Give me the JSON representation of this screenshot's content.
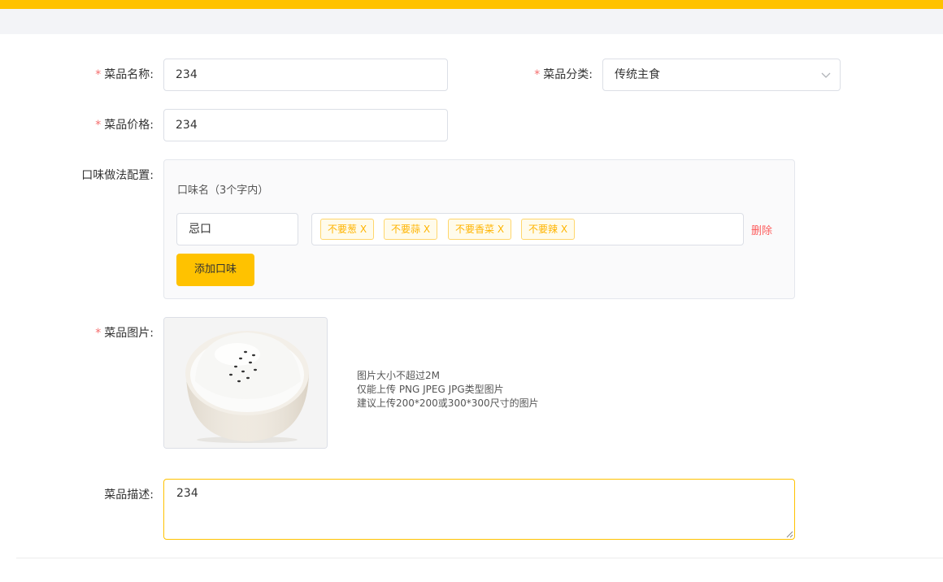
{
  "form": {
    "name": {
      "label": "菜品名称:",
      "required": "*",
      "value": "234"
    },
    "category": {
      "label": "菜品分类:",
      "required": "*",
      "value": "传统主食"
    },
    "price": {
      "label": "菜品价格:",
      "required": "*",
      "value": "234"
    },
    "flavor": {
      "label": "口味做法配置:",
      "hint": "口味名（3个字内）",
      "rows": [
        {
          "name": "忌口",
          "tags": [
            "不要葱 X",
            "不要蒜 X",
            "不要香菜 X",
            "不要辣 X"
          ],
          "delete_label": "删除"
        }
      ],
      "add_label": "添加口味"
    },
    "image": {
      "label": "菜品图片:",
      "required": "*",
      "tips": [
        "图片大小不超过2M",
        "仅能上传 PNG JPEG JPG类型图片",
        "建议上传200*200或300*300尺寸的图片"
      ]
    },
    "description": {
      "label": "菜品描述:",
      "value": "234"
    }
  },
  "colors": {
    "accent": "#ffc200",
    "danger": "#f56c6c",
    "tag_text": "#ffb400"
  },
  "icons": {
    "select_arrow": "chevron-down-icon",
    "image": "rice-bowl-photo"
  }
}
